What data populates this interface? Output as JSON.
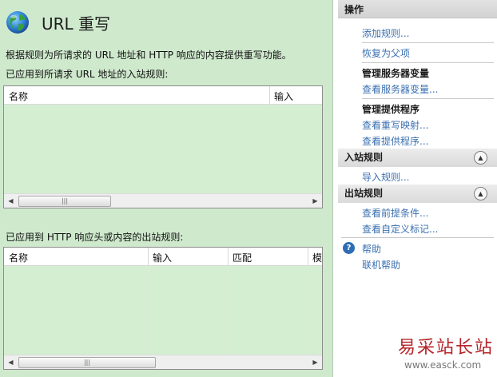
{
  "header": {
    "title": "URL 重写"
  },
  "description": "根据规则为所请求的 URL 地址和 HTTP 响应的内容提供重写功能。",
  "inbound": {
    "label": "已应用到所请求 URL 地址的入站规则:",
    "columns": [
      "名称",
      "输入"
    ]
  },
  "outbound": {
    "label": "已应用到 HTTP 响应头或内容的出站规则:",
    "columns": [
      "名称",
      "输入",
      "匹配",
      "模"
    ]
  },
  "scroll": {
    "left": "◀",
    "right": "▶",
    "grip": "|||"
  },
  "actions": {
    "title": "操作",
    "add_rule": "添加规则...",
    "revert_parent": "恢复为父项",
    "manage_server_vars": "管理服务器变量",
    "view_server_vars": "查看服务器变量...",
    "manage_providers": "管理提供程序",
    "view_rewrite_maps": "查看重写映射...",
    "view_providers": "查看提供程序...",
    "inbound_group": "入站规则",
    "import_rules": "导入规则...",
    "outbound_group": "出站规则",
    "view_preconditions": "查看前提条件...",
    "view_custom_tags": "查看自定义标记...",
    "help": "帮助",
    "online_help": "联机帮助",
    "collapse_glyph": "▲",
    "help_glyph": "?"
  },
  "watermark": {
    "main": "易采站长站",
    "sub": "www.easck.com"
  },
  "colors": {
    "pane_green": "#cfe9cd",
    "link_blue": "#3a6fb0",
    "watermark_red": "#b5242a"
  }
}
